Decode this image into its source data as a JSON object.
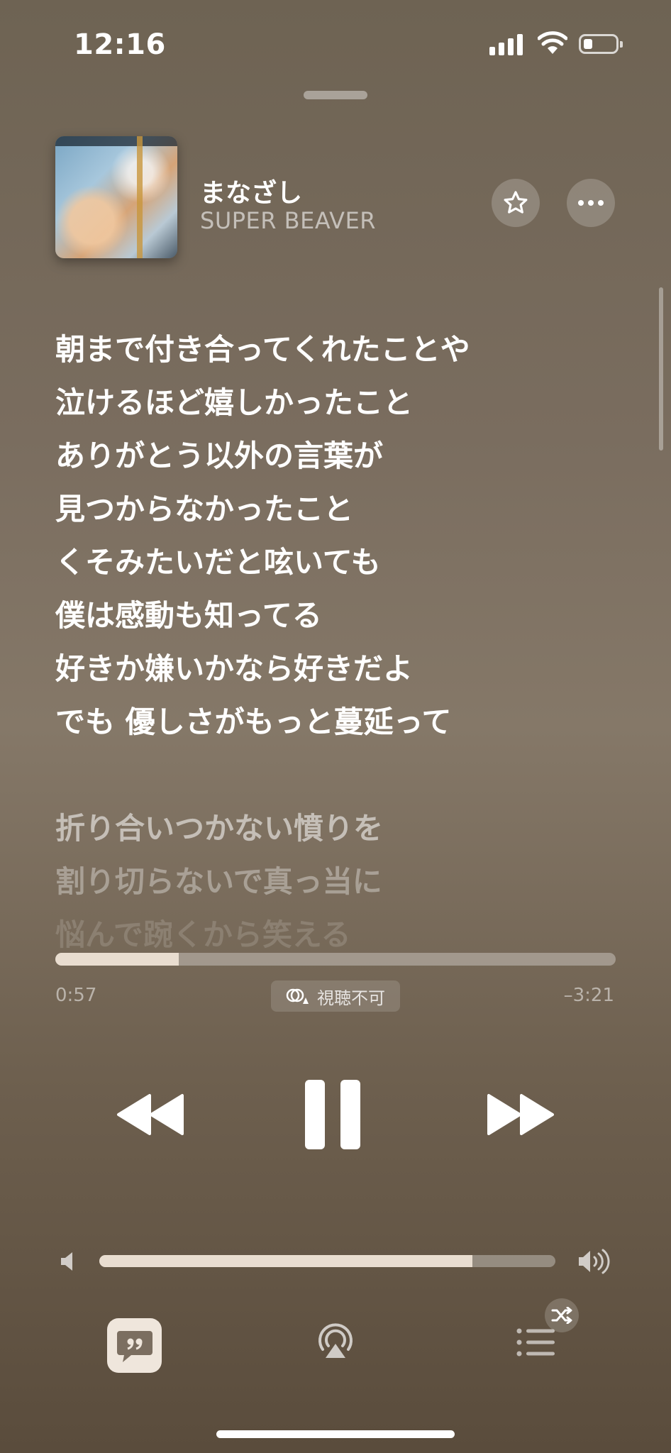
{
  "status_bar": {
    "time": "12:16"
  },
  "now_playing": {
    "title": "まなざし",
    "artist": "SUPER BEAVER"
  },
  "lyrics": {
    "active": [
      "朝まで付き合ってくれたことや",
      "泣けるほど嬉しかったこと",
      "ありがとう以外の言葉が",
      "見つからなかったこと",
      "くそみたいだと呟いても",
      "僕は感動も知ってる",
      "好きか嫌いかなら好きだよ",
      "でも 優しさがもっと蔓延って"
    ],
    "upcoming": [
      "折り合いつかない憤りを",
      "割り切らないで真っ当に",
      "悩んで踠くから笑える"
    ]
  },
  "playback": {
    "elapsed": "0:57",
    "remaining": "–3:21",
    "progress_fraction": 0.22,
    "badge_label": "視聴不可",
    "volume_fraction": 0.818
  },
  "colors": {
    "accent_fill": "#e9ddd0",
    "lyrics_button_bg": "#efe6dc"
  },
  "icons": {
    "favorite": "star-icon",
    "more": "ellipsis-icon",
    "previous": "backward-icon",
    "pause": "pause-icon",
    "next": "forward-icon",
    "lyrics": "quote-bubble-icon",
    "airplay": "airplay-icon",
    "queue": "list-icon",
    "shuffle": "shuffle-icon"
  }
}
